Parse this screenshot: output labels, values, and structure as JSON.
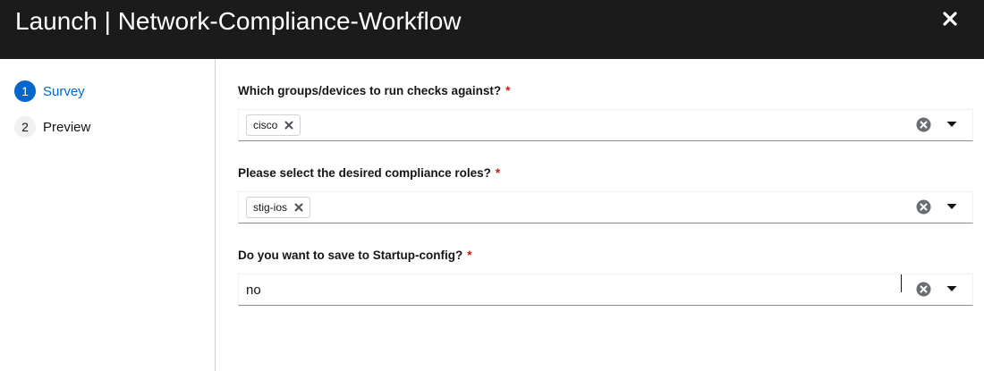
{
  "header": {
    "title": "Launch | Network-Compliance-Workflow",
    "close_icon": "close-icon"
  },
  "colors": {
    "header_bg": "#1b1b1b",
    "accent": "#0066cc",
    "required": "#c9190b"
  },
  "sidebar": {
    "steps": [
      {
        "number": "1",
        "label": "Survey",
        "active": true
      },
      {
        "number": "2",
        "label": "Preview",
        "active": false
      }
    ]
  },
  "form": {
    "fields": [
      {
        "label": "Which groups/devices to run checks against?",
        "required_mark": "*",
        "type": "multiselect",
        "chips": [
          "cisco"
        ]
      },
      {
        "label": "Please select the desired compliance roles?",
        "required_mark": "*",
        "type": "multiselect",
        "chips": [
          "stig-ios"
        ]
      },
      {
        "label": "Do you want to save to Startup-config?",
        "required_mark": "*",
        "type": "typeahead",
        "value": "no"
      }
    ]
  }
}
